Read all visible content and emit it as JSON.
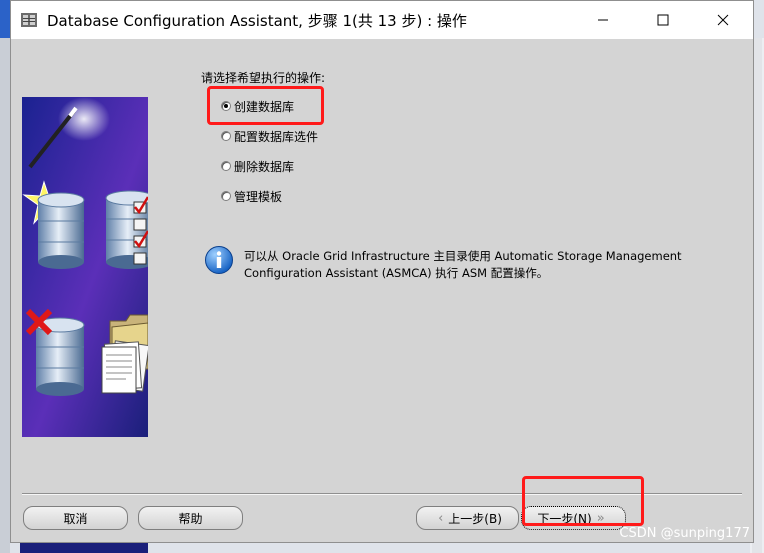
{
  "window": {
    "title": "Database Configuration Assistant, 步骤 1(共 13 步) : 操作"
  },
  "operations": {
    "prompt": "请选择希望执行的操作:",
    "options": [
      {
        "label": "创建数据库",
        "selected": true
      },
      {
        "label": "配置数据库选件",
        "selected": false
      },
      {
        "label": "删除数据库",
        "selected": false
      },
      {
        "label": "管理模板",
        "selected": false
      }
    ]
  },
  "info": {
    "text": "可以从 Oracle Grid Infrastructure 主目录使用 Automatic Storage Management Configuration Assistant (ASMCA) 执行 ASM 配置操作。"
  },
  "buttons": {
    "cancel": "取消",
    "help": "帮助",
    "back": "上一步(B)",
    "next": "下一步(N)"
  },
  "watermark": "CSDN @sunping177",
  "colors": {
    "highlight": "#ff1a1a",
    "dialog_bg": "#d4d4d4",
    "art_blue": "#1f2a9a"
  }
}
